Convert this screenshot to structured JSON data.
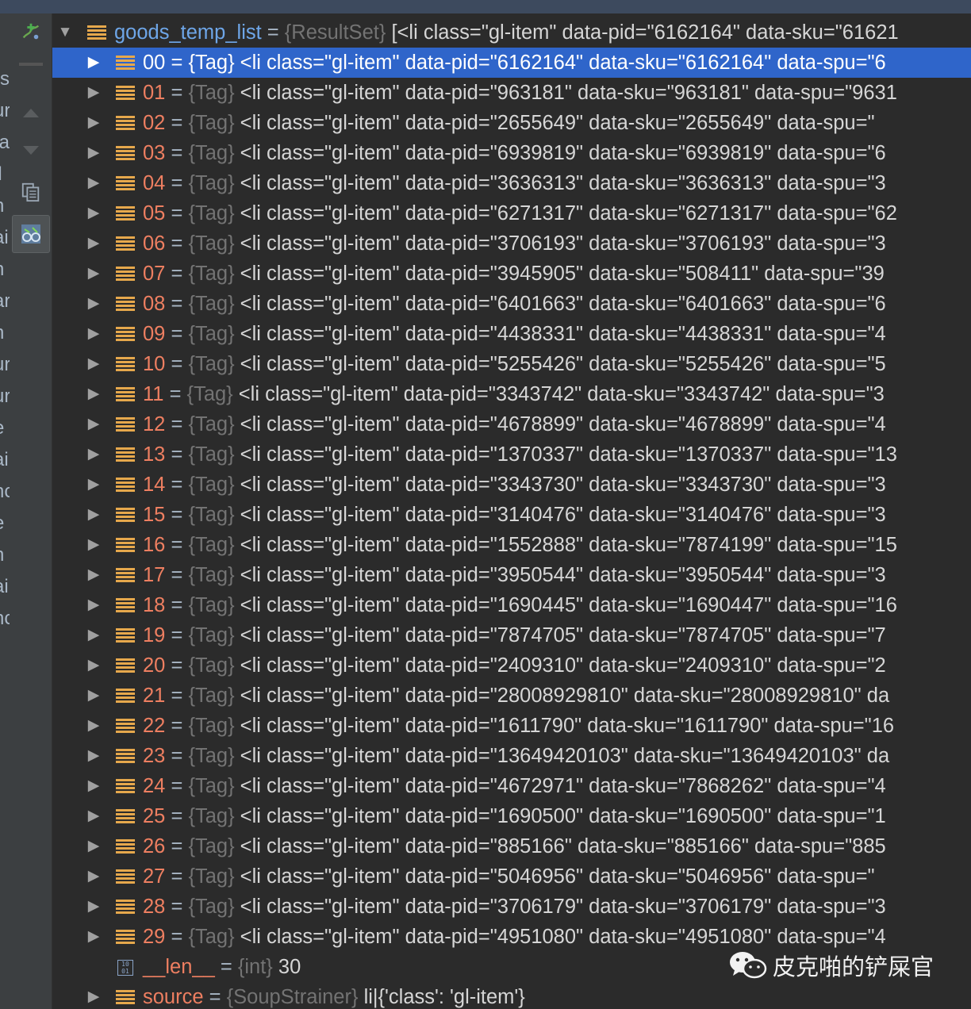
{
  "colors": {
    "selection": "#2f65ca",
    "name": "#ee7f61",
    "type": "#737373",
    "root_name": "#6ea6e8",
    "list_icon": "#e6a84c"
  },
  "left_fragments": [
    "rs",
    "ur",
    "ta",
    "ll",
    "n",
    "ai",
    "n",
    "ar",
    "n",
    "ur",
    "ur",
    "e",
    "ai",
    "nc",
    "e",
    "n",
    "ai",
    "nc"
  ],
  "toolbar": {
    "add_watch_icon": "add-watch-icon",
    "up_icon": "arrow-up-icon",
    "down_icon": "arrow-down-icon",
    "copy_icon": "copy-icon",
    "glasses_icon": "glasses-icon"
  },
  "root": {
    "name": "goods_temp_list",
    "eq": " = ",
    "type": "{ResultSet}",
    "value": " [<li class=\"gl-item\" data-pid=\"6162164\" data-sku=\"61621"
  },
  "items": [
    {
      "name": "00",
      "eq": " = ",
      "type": "{Tag}",
      "value": " <li class=\"gl-item\" data-pid=\"6162164\" data-sku=\"6162164\" data-spu=\"6"
    },
    {
      "name": "01",
      "eq": " = ",
      "type": "{Tag}",
      "value": " <li class=\"gl-item\" data-pid=\"963181\" data-sku=\"963181\" data-spu=\"9631"
    },
    {
      "name": "02",
      "eq": " = ",
      "type": "{Tag}",
      "value": " <li class=\"gl-item\" data-pid=\"2655649\" data-sku=\"2655649\" data-spu=\""
    },
    {
      "name": "03",
      "eq": " = ",
      "type": "{Tag}",
      "value": " <li class=\"gl-item\" data-pid=\"6939819\" data-sku=\"6939819\" data-spu=\"6"
    },
    {
      "name": "04",
      "eq": " = ",
      "type": "{Tag}",
      "value": " <li class=\"gl-item\" data-pid=\"3636313\" data-sku=\"3636313\" data-spu=\"3"
    },
    {
      "name": "05",
      "eq": " = ",
      "type": "{Tag}",
      "value": " <li class=\"gl-item\" data-pid=\"6271317\" data-sku=\"6271317\" data-spu=\"62"
    },
    {
      "name": "06",
      "eq": " = ",
      "type": "{Tag}",
      "value": " <li class=\"gl-item\" data-pid=\"3706193\" data-sku=\"3706193\" data-spu=\"3"
    },
    {
      "name": "07",
      "eq": " = ",
      "type": "{Tag}",
      "value": " <li class=\"gl-item\" data-pid=\"3945905\" data-sku=\"508411\" data-spu=\"39"
    },
    {
      "name": "08",
      "eq": " = ",
      "type": "{Tag}",
      "value": " <li class=\"gl-item\" data-pid=\"6401663\" data-sku=\"6401663\" data-spu=\"6"
    },
    {
      "name": "09",
      "eq": " = ",
      "type": "{Tag}",
      "value": " <li class=\"gl-item\" data-pid=\"4438331\" data-sku=\"4438331\" data-spu=\"4"
    },
    {
      "name": "10",
      "eq": " = ",
      "type": "{Tag}",
      "value": " <li class=\"gl-item\" data-pid=\"5255426\" data-sku=\"5255426\" data-spu=\"5"
    },
    {
      "name": "11",
      "eq": " = ",
      "type": "{Tag}",
      "value": " <li class=\"gl-item\" data-pid=\"3343742\" data-sku=\"3343742\" data-spu=\"3"
    },
    {
      "name": "12",
      "eq": " = ",
      "type": "{Tag}",
      "value": " <li class=\"gl-item\" data-pid=\"4678899\" data-sku=\"4678899\" data-spu=\"4"
    },
    {
      "name": "13",
      "eq": " = ",
      "type": "{Tag}",
      "value": " <li class=\"gl-item\" data-pid=\"1370337\" data-sku=\"1370337\" data-spu=\"13"
    },
    {
      "name": "14",
      "eq": " = ",
      "type": "{Tag}",
      "value": " <li class=\"gl-item\" data-pid=\"3343730\" data-sku=\"3343730\" data-spu=\"3"
    },
    {
      "name": "15",
      "eq": " = ",
      "type": "{Tag}",
      "value": " <li class=\"gl-item\" data-pid=\"3140476\" data-sku=\"3140476\" data-spu=\"3"
    },
    {
      "name": "16",
      "eq": " = ",
      "type": "{Tag}",
      "value": " <li class=\"gl-item\" data-pid=\"1552888\" data-sku=\"7874199\" data-spu=\"15"
    },
    {
      "name": "17",
      "eq": " = ",
      "type": "{Tag}",
      "value": " <li class=\"gl-item\" data-pid=\"3950544\" data-sku=\"3950544\" data-spu=\"3"
    },
    {
      "name": "18",
      "eq": " = ",
      "type": "{Tag}",
      "value": " <li class=\"gl-item\" data-pid=\"1690445\" data-sku=\"1690447\" data-spu=\"16"
    },
    {
      "name": "19",
      "eq": " = ",
      "type": "{Tag}",
      "value": " <li class=\"gl-item\" data-pid=\"7874705\" data-sku=\"7874705\" data-spu=\"7"
    },
    {
      "name": "20",
      "eq": " = ",
      "type": "{Tag}",
      "value": " <li class=\"gl-item\" data-pid=\"2409310\" data-sku=\"2409310\" data-spu=\"2"
    },
    {
      "name": "21",
      "eq": " = ",
      "type": "{Tag}",
      "value": " <li class=\"gl-item\" data-pid=\"28008929810\" data-sku=\"28008929810\" da"
    },
    {
      "name": "22",
      "eq": " = ",
      "type": "{Tag}",
      "value": " <li class=\"gl-item\" data-pid=\"1611790\" data-sku=\"1611790\" data-spu=\"16"
    },
    {
      "name": "23",
      "eq": " = ",
      "type": "{Tag}",
      "value": " <li class=\"gl-item\" data-pid=\"13649420103\" data-sku=\"13649420103\" da"
    },
    {
      "name": "24",
      "eq": " = ",
      "type": "{Tag}",
      "value": " <li class=\"gl-item\" data-pid=\"4672971\" data-sku=\"7868262\" data-spu=\"4"
    },
    {
      "name": "25",
      "eq": " = ",
      "type": "{Tag}",
      "value": " <li class=\"gl-item\" data-pid=\"1690500\" data-sku=\"1690500\" data-spu=\"1"
    },
    {
      "name": "26",
      "eq": " = ",
      "type": "{Tag}",
      "value": " <li class=\"gl-item\" data-pid=\"885166\" data-sku=\"885166\" data-spu=\"885"
    },
    {
      "name": "27",
      "eq": " = ",
      "type": "{Tag}",
      "value": " <li class=\"gl-item\" data-pid=\"5046956\" data-sku=\"5046956\" data-spu=\""
    },
    {
      "name": "28",
      "eq": " = ",
      "type": "{Tag}",
      "value": " <li class=\"gl-item\" data-pid=\"3706179\" data-sku=\"3706179\" data-spu=\"3"
    },
    {
      "name": "29",
      "eq": " = ",
      "type": "{Tag}",
      "value": " <li class=\"gl-item\" data-pid=\"4951080\" data-sku=\"4951080\" data-spu=\"4"
    }
  ],
  "len_item": {
    "icon_text": "10\n01",
    "name": "__len__",
    "eq": " = ",
    "type": "{int}",
    "value": " 30"
  },
  "source_item": {
    "name": "source",
    "eq": " = ",
    "type": "{SoupStrainer}",
    "value": " li|{'class': 'gl-item'}"
  },
  "watermark": {
    "text": "皮克啪的铲屎官",
    "icon": "wechat-icon"
  }
}
